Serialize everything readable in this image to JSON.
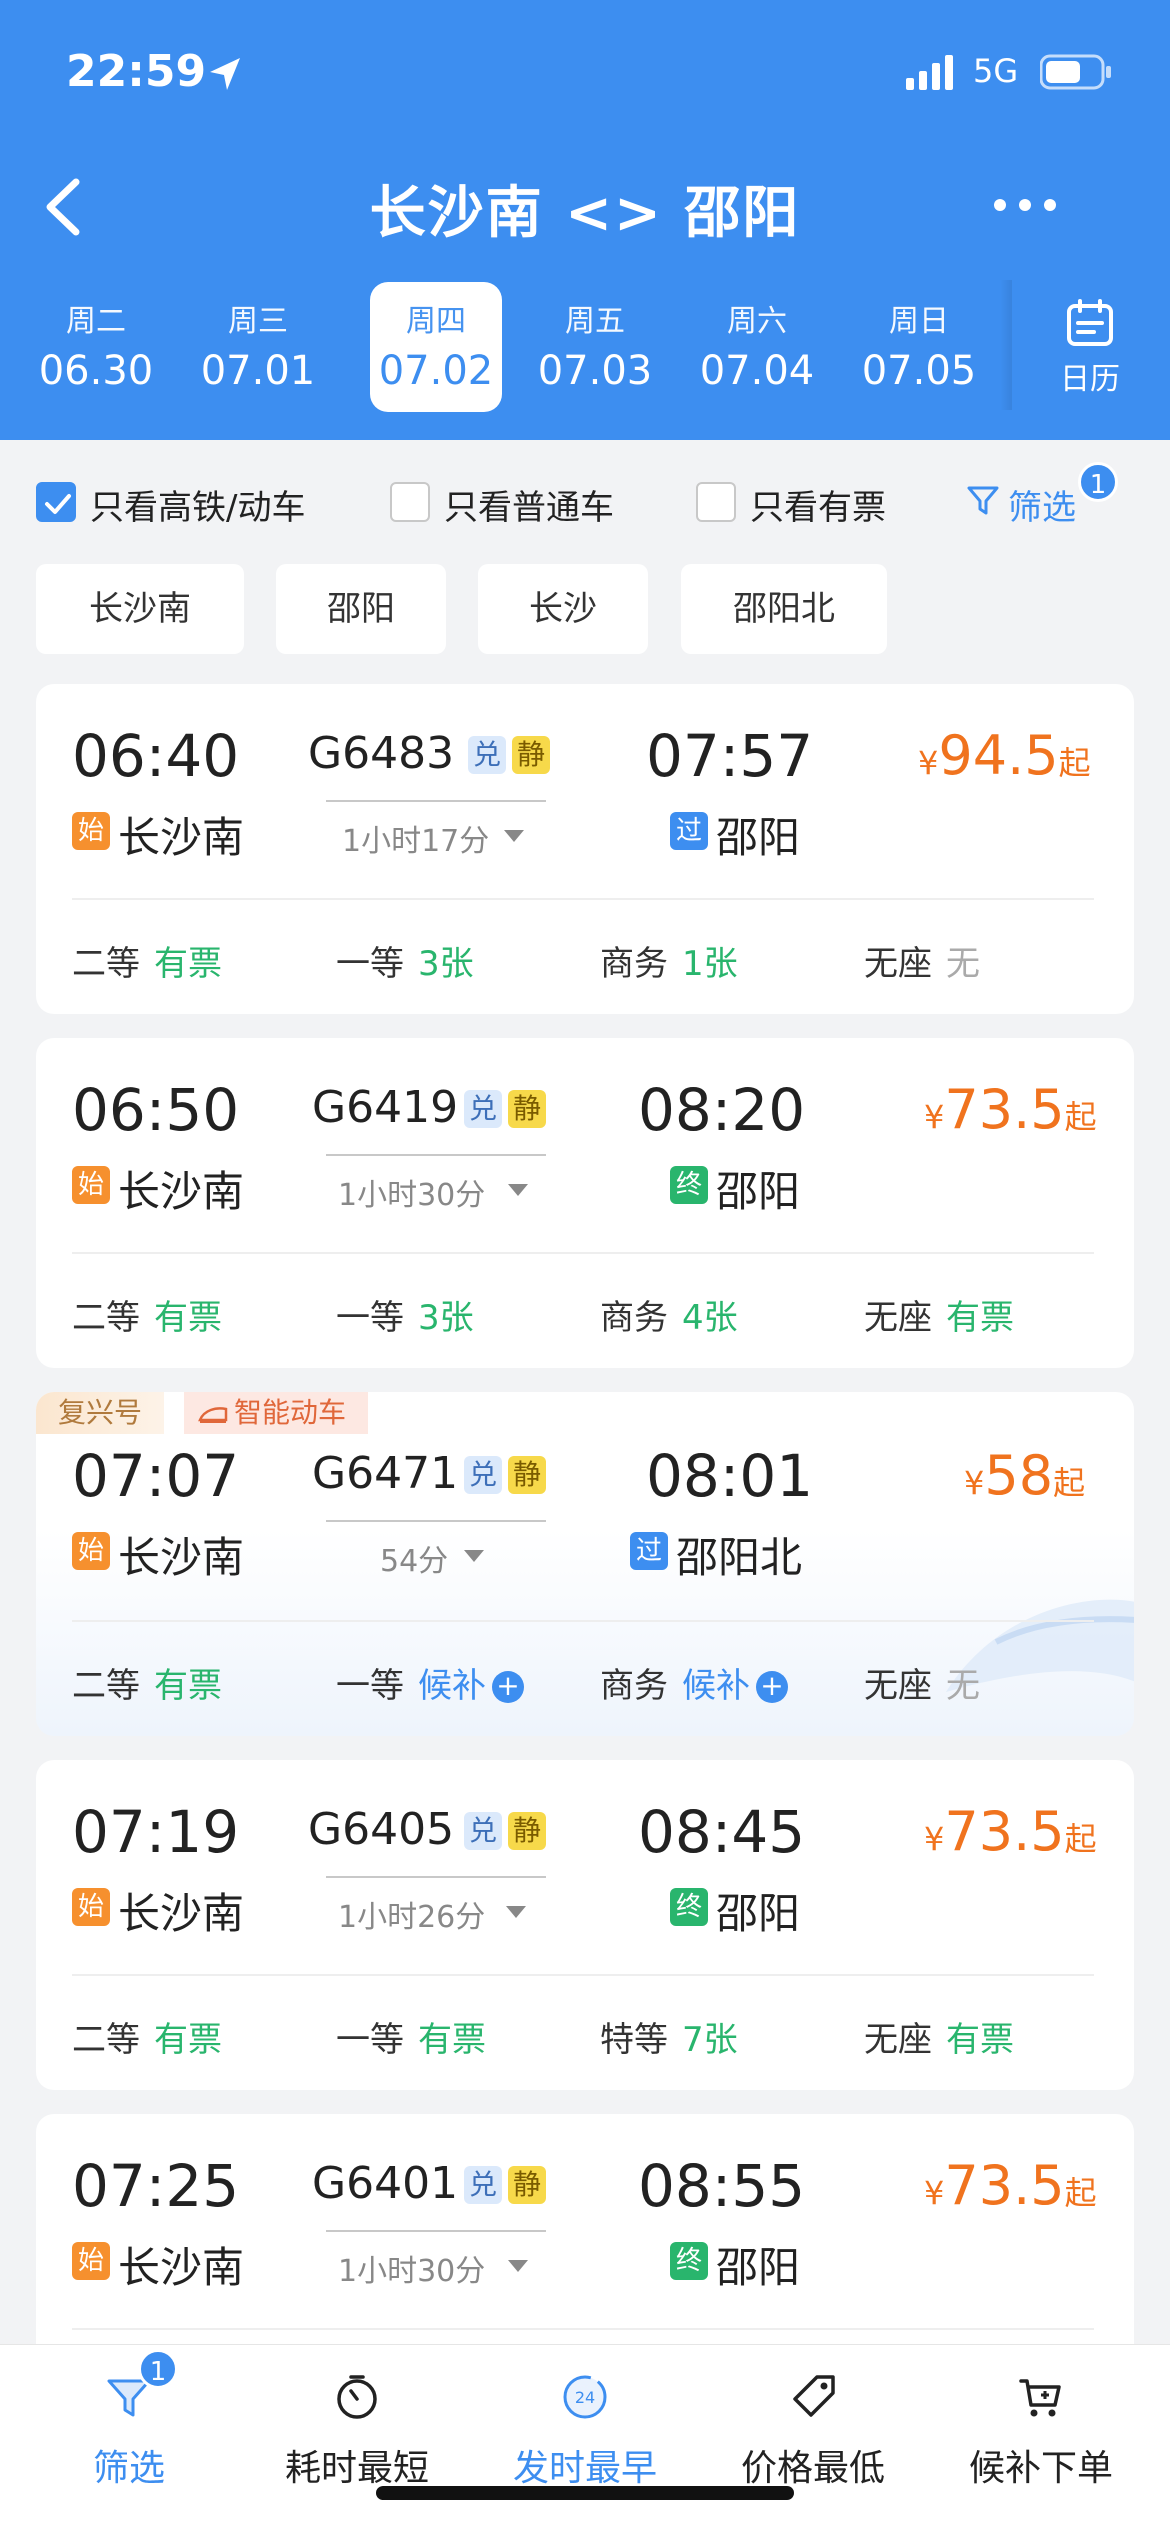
{
  "status_bar": {
    "time": "22:59",
    "network": "5G"
  },
  "header": {
    "title": "长沙南 <> 邵阳",
    "calendar_label": "日历"
  },
  "dates": [
    {
      "weekday": "周二",
      "date": "06.30"
    },
    {
      "weekday": "周三",
      "date": "07.01"
    },
    {
      "weekday": "周四",
      "date": "07.02",
      "active": true
    },
    {
      "weekday": "周五",
      "date": "07.03"
    },
    {
      "weekday": "周六",
      "date": "07.04"
    },
    {
      "weekday": "周日",
      "date": "07.05"
    }
  ],
  "filters": {
    "high_speed_only": "只看高铁/动车",
    "normal_only": "只看普通车",
    "available_only": "只看有票",
    "filter_label": "筛选",
    "filter_count": "1"
  },
  "stations": [
    "长沙南",
    "邵阳",
    "长沙",
    "邵阳北"
  ],
  "trains": [
    {
      "dep_time": "06:40",
      "train_no": "G6483",
      "tag1": "兑",
      "tag2": "静",
      "arr_time": "07:57",
      "duration": "1小时17分",
      "dep_icon": "始",
      "dep_station": "长沙南",
      "arr_icon": "过",
      "arr_station": "邵阳",
      "price_currency": "¥",
      "price": "94.5",
      "price_suffix": "起",
      "seats": [
        {
          "type": "二等",
          "avail": "有票"
        },
        {
          "type": "一等",
          "avail": "3张"
        },
        {
          "type": "商务",
          "avail": "1张"
        },
        {
          "type": "无座",
          "avail": "无"
        }
      ]
    },
    {
      "dep_time": "06:50",
      "train_no": "G6419",
      "tag1": "兑",
      "tag2": "静",
      "arr_time": "08:20",
      "duration": "1小时30分",
      "dep_icon": "始",
      "dep_station": "长沙南",
      "arr_icon": "终",
      "arr_station": "邵阳",
      "price_currency": "¥",
      "price": "73.5",
      "price_suffix": "起",
      "seats": [
        {
          "type": "二等",
          "avail": "有票"
        },
        {
          "type": "一等",
          "avail": "3张"
        },
        {
          "type": "商务",
          "avail": "4张"
        },
        {
          "type": "无座",
          "avail": "有票"
        }
      ]
    },
    {
      "labels": [
        "复兴号",
        "智能动车"
      ],
      "dep_time": "07:07",
      "train_no": "G6471",
      "tag1": "兑",
      "tag2": "静",
      "arr_time": "08:01",
      "duration": "54分",
      "dep_icon": "始",
      "dep_station": "长沙南",
      "arr_icon": "过",
      "arr_station": "邵阳北",
      "price_currency": "¥",
      "price": "58",
      "price_suffix": "起",
      "seats": [
        {
          "type": "二等",
          "avail": "有票"
        },
        {
          "type": "一等",
          "avail": "候补"
        },
        {
          "type": "商务",
          "avail": "候补"
        },
        {
          "type": "无座",
          "avail": "无"
        }
      ]
    },
    {
      "dep_time": "07:19",
      "train_no": "G6405",
      "tag1": "兑",
      "tag2": "静",
      "arr_time": "08:45",
      "duration": "1小时26分",
      "dep_icon": "始",
      "dep_station": "长沙南",
      "arr_icon": "终",
      "arr_station": "邵阳",
      "price_currency": "¥",
      "price": "73.5",
      "price_suffix": "起",
      "seats": [
        {
          "type": "二等",
          "avail": "有票"
        },
        {
          "type": "一等",
          "avail": "有票"
        },
        {
          "type": "特等",
          "avail": "7张"
        },
        {
          "type": "无座",
          "avail": "有票"
        }
      ]
    },
    {
      "dep_time": "07:25",
      "train_no": "G6401",
      "tag1": "兑",
      "tag2": "静",
      "arr_time": "08:55",
      "duration": "1小时30分",
      "dep_icon": "始",
      "dep_station": "长沙南",
      "arr_icon": "终",
      "arr_station": "邵阳",
      "price_currency": "¥",
      "price": "73.5",
      "price_suffix": "起"
    }
  ],
  "bottom_bar": {
    "filter": "筛选",
    "filter_count": "1",
    "shortest": "耗时最短",
    "earliest": "发时最早",
    "earliest_icon_text": "24",
    "cheapest": "价格最低",
    "waitlist": "候补下单"
  },
  "colors": {
    "primary": "#3d8ef0",
    "price": "#f0731e",
    "available": "#29b56d"
  }
}
